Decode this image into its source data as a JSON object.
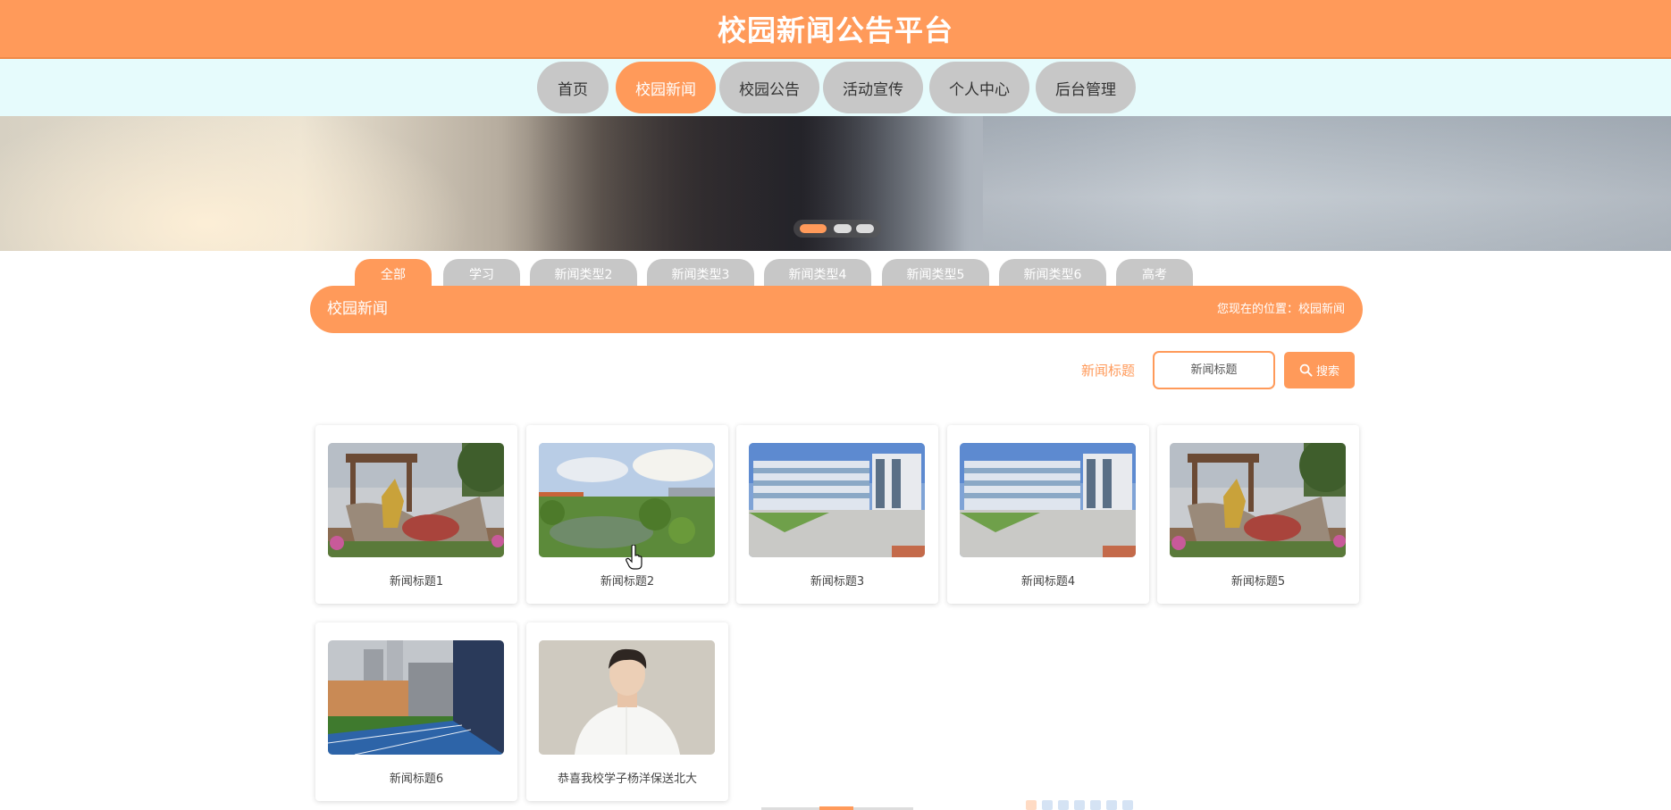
{
  "site": {
    "title": "校园新闻公告平台"
  },
  "nav": {
    "items": [
      {
        "label": "首页",
        "active": false
      },
      {
        "label": "校园新闻",
        "active": true
      },
      {
        "label": "校园公告",
        "active": false
      },
      {
        "label": "活动宣传",
        "active": false
      },
      {
        "label": "个人中心",
        "active": false
      },
      {
        "label": "后台管理",
        "active": false
      }
    ]
  },
  "banner": {
    "slides": 3,
    "active_slide": 1
  },
  "categories": {
    "items": [
      {
        "label": "全部",
        "active": true
      },
      {
        "label": "学习",
        "active": false
      },
      {
        "label": "新闻类型2",
        "active": false
      },
      {
        "label": "新闻类型3",
        "active": false
      },
      {
        "label": "新闻类型4",
        "active": false
      },
      {
        "label": "新闻类型5",
        "active": false
      },
      {
        "label": "新闻类型6",
        "active": false
      },
      {
        "label": "高考",
        "active": false
      }
    ]
  },
  "section": {
    "title": "校园新闻",
    "breadcrumb": "您现在的位置：校园新闻"
  },
  "search": {
    "label": "新闻标题",
    "placeholder": "新闻标题",
    "button_label": "搜索"
  },
  "news": [
    {
      "title": "新闻标题1",
      "image": "campus-sculpture"
    },
    {
      "title": "新闻标题2",
      "image": "campus-lake"
    },
    {
      "title": "新闻标题3",
      "image": "campus-building"
    },
    {
      "title": "新闻标题4",
      "image": "campus-building"
    },
    {
      "title": "新闻标题5",
      "image": "campus-sculpture"
    },
    {
      "title": "新闻标题6",
      "image": "campus-track"
    },
    {
      "title": "恭喜我校学子杨洋保送北大",
      "image": "student-portrait"
    }
  ],
  "colors": {
    "accent": "#ff9a5a",
    "tab_inactive": "#c7c7c7",
    "nav_background": "#e6fbfc"
  }
}
